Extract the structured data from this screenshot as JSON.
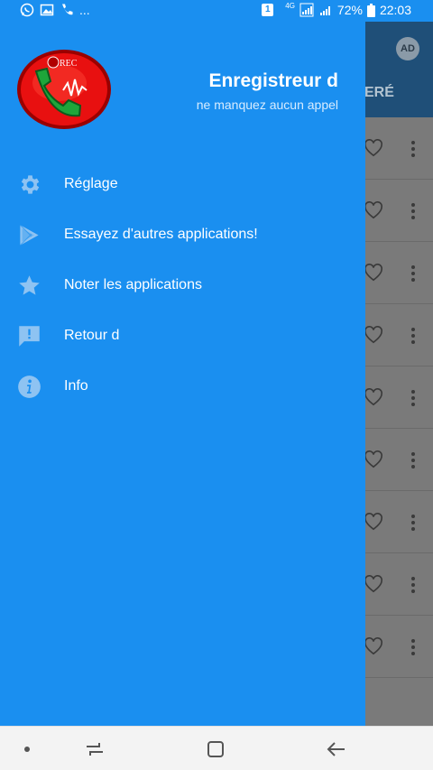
{
  "status_bar": {
    "left_icons": [
      "whatsapp-icon",
      "gallery-icon",
      "phone-icon"
    ],
    "more": "...",
    "sim_badge": "1",
    "network": "4G",
    "battery_percent": "72%",
    "time": "22:03"
  },
  "background_app": {
    "ad_badge": "AD",
    "tab_fragment": "ERÉ",
    "row_count": 9
  },
  "drawer": {
    "logo_text": "REC",
    "app_title": "Enregistreur d",
    "app_subtitle": "ne manquez aucun appel",
    "items": [
      {
        "icon": "gear-icon",
        "label": "Réglage"
      },
      {
        "icon": "play-store-icon",
        "label": "Essayez d'autres applications!"
      },
      {
        "icon": "star-icon",
        "label": "Noter les applications"
      },
      {
        "icon": "feedback-icon",
        "label": "Retour d"
      },
      {
        "icon": "info-icon",
        "label": "Info"
      }
    ]
  },
  "nav_bar": {
    "buttons": [
      "dot-icon",
      "recents-icon",
      "home-icon",
      "back-icon"
    ]
  },
  "colors": {
    "drawer": "#1a8ff0",
    "icon": "#8ec3f2",
    "text": "#ffffff",
    "scrim": "#7a7a7a"
  }
}
